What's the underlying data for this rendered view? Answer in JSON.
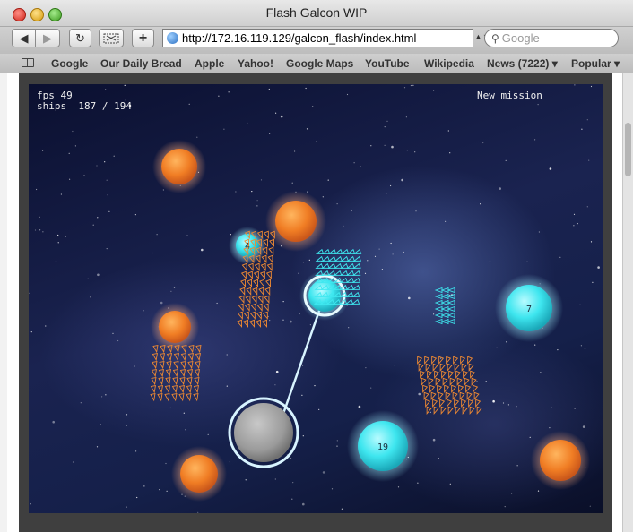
{
  "window": {
    "title": "Flash Galcon WIP"
  },
  "toolbar": {
    "back_icon": "◀",
    "forward_icon": "▶",
    "reload_icon": "↻",
    "add_icon": "+",
    "url": "http://172.16.119.129/galcon_flash/index.html",
    "search_placeholder": "Google"
  },
  "bookmarks": {
    "items": [
      "Google",
      "Our Daily Bread",
      "Apple",
      "Yahoo!",
      "Google Maps",
      "YouTube",
      "Wikipedia",
      "News (7222)",
      "Popular"
    ]
  },
  "game": {
    "fps_label": "fps 49",
    "ships_label": "ships  187 / 194",
    "new_mission": "New mission",
    "colors": {
      "player": "#3fe8f0",
      "enemy": "#f08a32",
      "neutral": "#9a9a9a",
      "selection": "#d8f4ff"
    },
    "planets": [
      {
        "owner": "enemy",
        "ships": ""
      },
      {
        "owner": "enemy",
        "ships": ""
      },
      {
        "owner": "player",
        "ships": "4"
      },
      {
        "owner": "player",
        "ships": ""
      },
      {
        "owner": "enemy",
        "ships": ""
      },
      {
        "owner": "player",
        "ships": "7"
      },
      {
        "owner": "neutral",
        "ships": ""
      },
      {
        "owner": "player",
        "ships": "19"
      },
      {
        "owner": "enemy",
        "ships": ""
      },
      {
        "owner": "enemy",
        "ships": ""
      }
    ]
  }
}
